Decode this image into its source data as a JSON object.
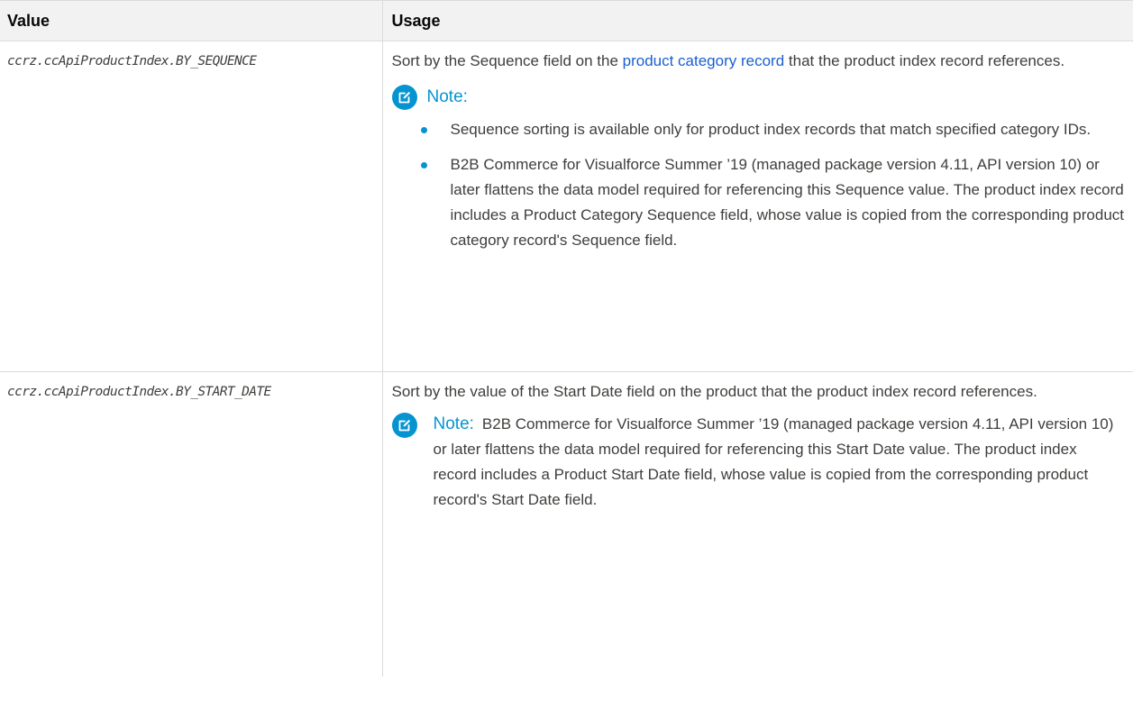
{
  "table": {
    "headers": [
      "Value",
      "Usage"
    ],
    "rows": [
      {
        "value": "ccrz.ccApiProductIndex.BY_SEQUENCE",
        "usage_before": "Sort by the Sequence field on the ",
        "usage_link": "product category record",
        "usage_after": " that the product index record references.",
        "note_label": "Note:",
        "note_items": [
          "Sequence sorting is available only for product index records that match specified category IDs.",
          "B2B Commerce for Visualforce Summer ’19 (managed package version 4.11, API version 10) or later flattens the data model required for referencing this Sequence value. The product index record includes a Product Category Sequence field, whose value is copied from the corresponding product category record's Sequence field."
        ]
      },
      {
        "value": "ccrz.ccApiProductIndex.BY_START_DATE",
        "usage": "Sort by the value of the Start Date field on the product that the product index record references.",
        "note_label": "Note:",
        "note_text": "B2B Commerce for Visualforce Summer ’19 (managed package version 4.11, API version 10) or later flattens the data model required for referencing this Start Date value. The product index record includes a Product Start Date field, whose value is copied from the corresponding product record's Start Date field."
      }
    ]
  },
  "colors": {
    "link": "#1b5fd0",
    "note_accent": "#0694d1",
    "header_bg": "#f3f2f2",
    "border": "#dddbda"
  },
  "icons": {
    "note": "edit-note-icon"
  }
}
